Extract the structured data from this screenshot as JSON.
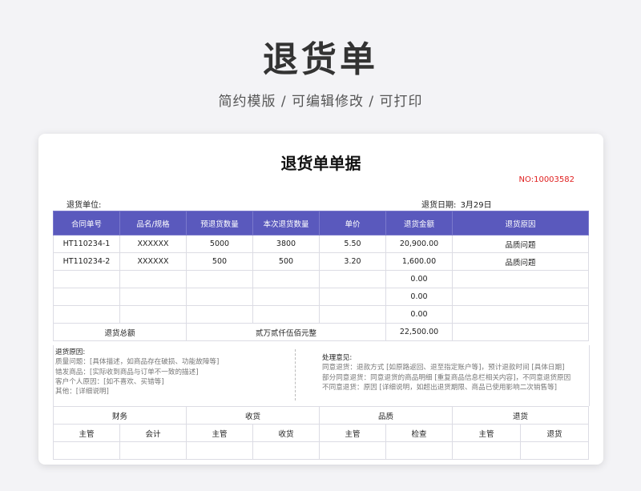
{
  "header": {
    "title": "退货单",
    "subtitle": "简约模版 / 可编辑修改 / 可打印"
  },
  "document": {
    "title": "退货单单据",
    "number": "NO:10003582",
    "unit_label": "退货单位:",
    "date_label": "退货日期:",
    "date_value": "3月29日"
  },
  "table": {
    "columns": [
      "合同单号",
      "品名/规格",
      "预退货数量",
      "本次退货数量",
      "单价",
      "退货金额",
      "退货原因"
    ],
    "rows": [
      [
        "HT110234-1",
        "XXXXXX",
        "5000",
        "3800",
        "5.50",
        "20,900.00",
        "品质问题"
      ],
      [
        "HT110234-2",
        "XXXXXX",
        "500",
        "500",
        "3.20",
        "1,600.00",
        "品质问题"
      ],
      [
        "",
        "",
        "",
        "",
        "",
        "0.00",
        ""
      ],
      [
        "",
        "",
        "",
        "",
        "",
        "0.00",
        ""
      ],
      [
        "",
        "",
        "",
        "",
        "",
        "0.00",
        ""
      ]
    ],
    "total": {
      "label": "退货总额",
      "in_words": "贰万贰仟伍佰元整",
      "amount": "22,500.00"
    }
  },
  "notes": {
    "reasons_title": "退货原因:",
    "reasons": [
      "质量问题：[具体描述，如商品存在破损、功能故障等]",
      "错发商品：[实际收到商品与订单不一致的描述]",
      "客户个人原因：[如不喜欢、买错等]",
      "其他：[详细说明]"
    ],
    "handling_title": "处理意见:",
    "handling": [
      "同意退货：退款方式 [如原路返回、退至指定账户等]，预计退款时间 [具体日期]",
      "部分同意退货：同意退货的商品明细 [重复商品信息栏相关内容]，不同意退货原因",
      "不同意退货：原因 [详细说明，如超出退货期限、商品已使用影响二次销售等]"
    ]
  },
  "signoff": {
    "groups": [
      "财务",
      "收货",
      "品质",
      "退货"
    ],
    "roles": [
      "主管",
      "会计",
      "主管",
      "收货",
      "主管",
      "检查",
      "主管",
      "退货"
    ]
  }
}
